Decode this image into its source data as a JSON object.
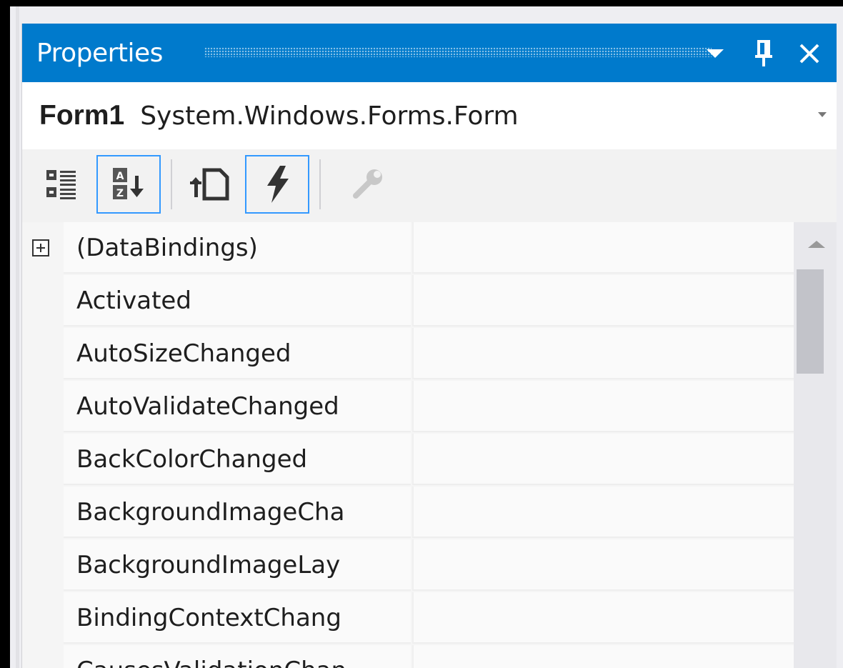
{
  "window": {
    "title": "Properties"
  },
  "selector": {
    "object_name": "Form1",
    "object_type": "System.Windows.Forms.Form"
  },
  "toolbar": {
    "buttons": [
      {
        "icon": "categorized-icon",
        "active": false
      },
      {
        "icon": "alphabetical-sort-icon",
        "active": true
      },
      {
        "icon": "properties-icon",
        "active": false
      },
      {
        "icon": "events-lightning-icon",
        "active": true
      },
      {
        "icon": "property-pages-wrench-icon",
        "active": false,
        "disabled": true
      }
    ]
  },
  "grid": {
    "rows": [
      {
        "name": "(DataBindings)",
        "value": "",
        "expandable": true
      },
      {
        "name": "Activated",
        "value": ""
      },
      {
        "name": "AutoSizeChanged",
        "value": ""
      },
      {
        "name": "AutoValidateChanged",
        "value": ""
      },
      {
        "name": "BackColorChanged",
        "value": ""
      },
      {
        "name": "BackgroundImageCha",
        "value": ""
      },
      {
        "name": "BackgroundImageLay",
        "value": ""
      },
      {
        "name": "BindingContextChang",
        "value": ""
      },
      {
        "name": "CausesValidationChan",
        "value": ""
      }
    ]
  },
  "colors": {
    "titlebar": "#007acc",
    "active_border": "#3399ff"
  }
}
